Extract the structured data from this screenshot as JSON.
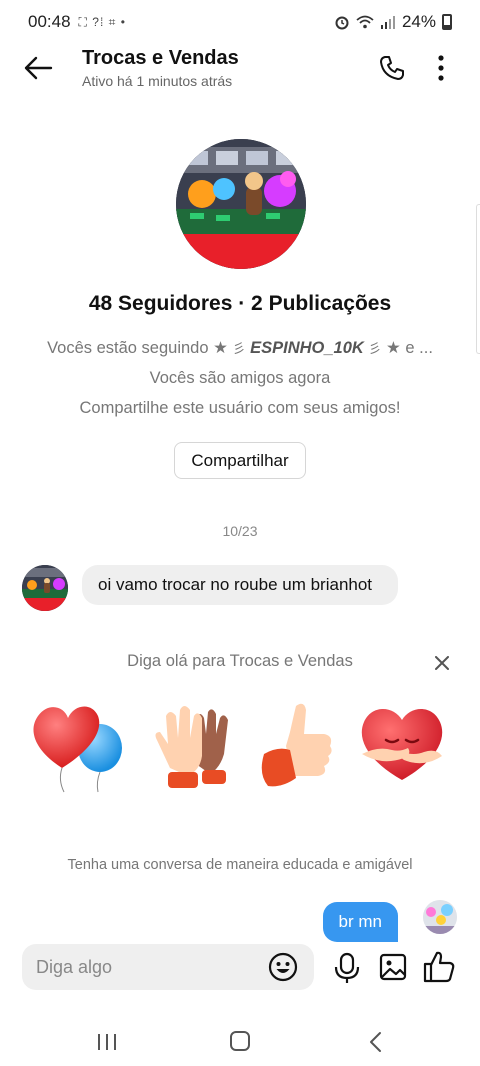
{
  "status_bar": {
    "time": "00:48",
    "left_icons": "⛶ ?⁞ ⌗ •",
    "battery": "24%",
    "icons": [
      "alarm-icon",
      "wifi-icon",
      "signal-icon",
      "battery-icon"
    ]
  },
  "header": {
    "title": "Trocas e Vendas",
    "subtitle": "Ativo há 1 minutos atrás",
    "icons": [
      "back-arrow-icon",
      "phone-icon",
      "more-vertical-icon"
    ]
  },
  "profile": {
    "stats": "48 Seguidores · 2 Publicações",
    "following_prefix": "Vocês estão seguindo ★",
    "following_name": "ESPINHO_10K",
    "following_suffix": "★ e ...",
    "friends_text": "Vocês são amigos agora",
    "share_prompt": "Compartilhe este usuário com seus amigos!",
    "share_button": "Compartilhar"
  },
  "chat": {
    "date": "10/23",
    "received_message": "oi vamo trocar no roube um brianhot",
    "hello_prompt": "Diga olá para Trocas e Vendas",
    "stickers": [
      "heart-balloons-sticker",
      "high-five-sticker",
      "thumbs-up-sticker",
      "heart-hug-sticker"
    ],
    "polite_note": "Tenha uma conversa de maneira educada e amigável",
    "sent_message": "br mn"
  },
  "composer": {
    "placeholder": "Diga algo"
  },
  "colors": {
    "accent_blue": "#3797f0",
    "bubble_gray": "#efefef",
    "muted_text": "#777777"
  }
}
